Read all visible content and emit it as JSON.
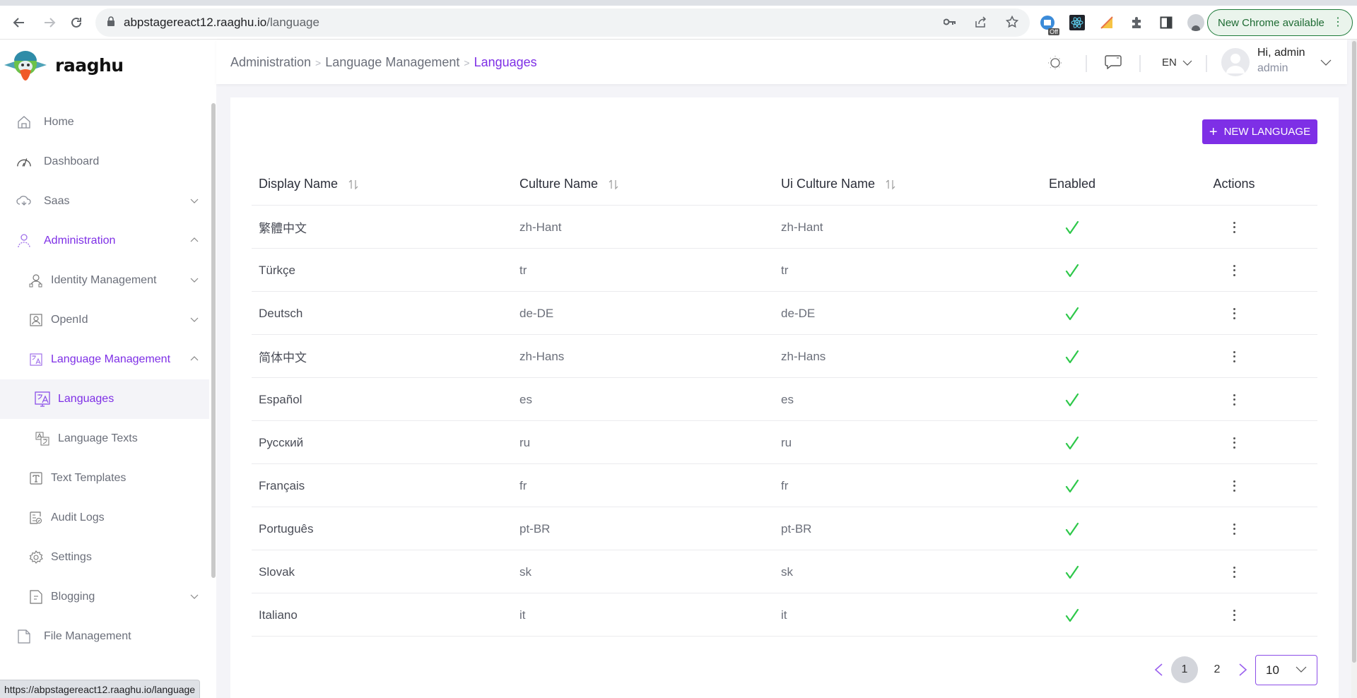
{
  "browser": {
    "url_host": "abpstagereact12.raaghu.io",
    "url_path": "/language",
    "update_label": "New Chrome available",
    "extension_badge": "Off",
    "status_url": "https://abpstagereact12.raaghu.io/language"
  },
  "brand": {
    "name": "raaghu"
  },
  "sidebar": {
    "items": [
      {
        "label": "Home",
        "icon": "home-icon",
        "level": 1
      },
      {
        "label": "Dashboard",
        "icon": "gauge-icon",
        "level": 1
      },
      {
        "label": "Saas",
        "icon": "cloud-icon",
        "level": 1,
        "chevron": "down"
      },
      {
        "label": "Administration",
        "icon": "admin-user-icon",
        "level": 1,
        "chevron": "up",
        "active": true
      },
      {
        "label": "Identity Management",
        "icon": "identity-icon",
        "level": 2,
        "chevron": "down"
      },
      {
        "label": "OpenId",
        "icon": "openid-icon",
        "level": 2,
        "chevron": "down"
      },
      {
        "label": "Language Management",
        "icon": "translate-icon",
        "level": 2,
        "chevron": "up",
        "active": true
      },
      {
        "label": "Languages",
        "icon": "languages-icon",
        "level": 3,
        "selected": true
      },
      {
        "label": "Language Texts",
        "icon": "language-texts-icon",
        "level": 3
      },
      {
        "label": "Text Templates",
        "icon": "text-template-icon",
        "level": 2
      },
      {
        "label": "Audit Logs",
        "icon": "audit-log-icon",
        "level": 2
      },
      {
        "label": "Settings",
        "icon": "settings-icon",
        "level": 2
      },
      {
        "label": "Blogging",
        "icon": "blog-icon",
        "level": 2,
        "chevron": "down"
      },
      {
        "label": "File Management",
        "icon": "file-icon",
        "level": 1
      }
    ]
  },
  "header": {
    "breadcrumb": [
      "Administration",
      "Language Management",
      "Languages"
    ],
    "language": "EN",
    "greeting": "Hi, admin",
    "role": "admin"
  },
  "toolbar": {
    "new_language_label": "NEW LANGUAGE"
  },
  "table": {
    "columns": [
      "Display Name",
      "Culture Name",
      "Ui Culture Name",
      "Enabled",
      "Actions"
    ],
    "rows": [
      {
        "display_name": "繁體中文",
        "culture_name": "zh-Hant",
        "ui_culture_name": "zh-Hant",
        "enabled": true
      },
      {
        "display_name": "Türkçe",
        "culture_name": "tr",
        "ui_culture_name": "tr",
        "enabled": true
      },
      {
        "display_name": "Deutsch",
        "culture_name": "de-DE",
        "ui_culture_name": "de-DE",
        "enabled": true
      },
      {
        "display_name": "简体中文",
        "culture_name": "zh-Hans",
        "ui_culture_name": "zh-Hans",
        "enabled": true
      },
      {
        "display_name": "Español",
        "culture_name": "es",
        "ui_culture_name": "es",
        "enabled": true
      },
      {
        "display_name": "Русский",
        "culture_name": "ru",
        "ui_culture_name": "ru",
        "enabled": true
      },
      {
        "display_name": "Français",
        "culture_name": "fr",
        "ui_culture_name": "fr",
        "enabled": true
      },
      {
        "display_name": "Português",
        "culture_name": "pt-BR",
        "ui_culture_name": "pt-BR",
        "enabled": true
      },
      {
        "display_name": "Slovak",
        "culture_name": "sk",
        "ui_culture_name": "sk",
        "enabled": true
      },
      {
        "display_name": "Italiano",
        "culture_name": "it",
        "ui_culture_name": "it",
        "enabled": true
      }
    ]
  },
  "pagination": {
    "pages": [
      "1",
      "2"
    ],
    "current": "1",
    "page_size": "10"
  },
  "colors": {
    "accent": "#7e2fe6",
    "enabled_check": "#2ec84a"
  }
}
